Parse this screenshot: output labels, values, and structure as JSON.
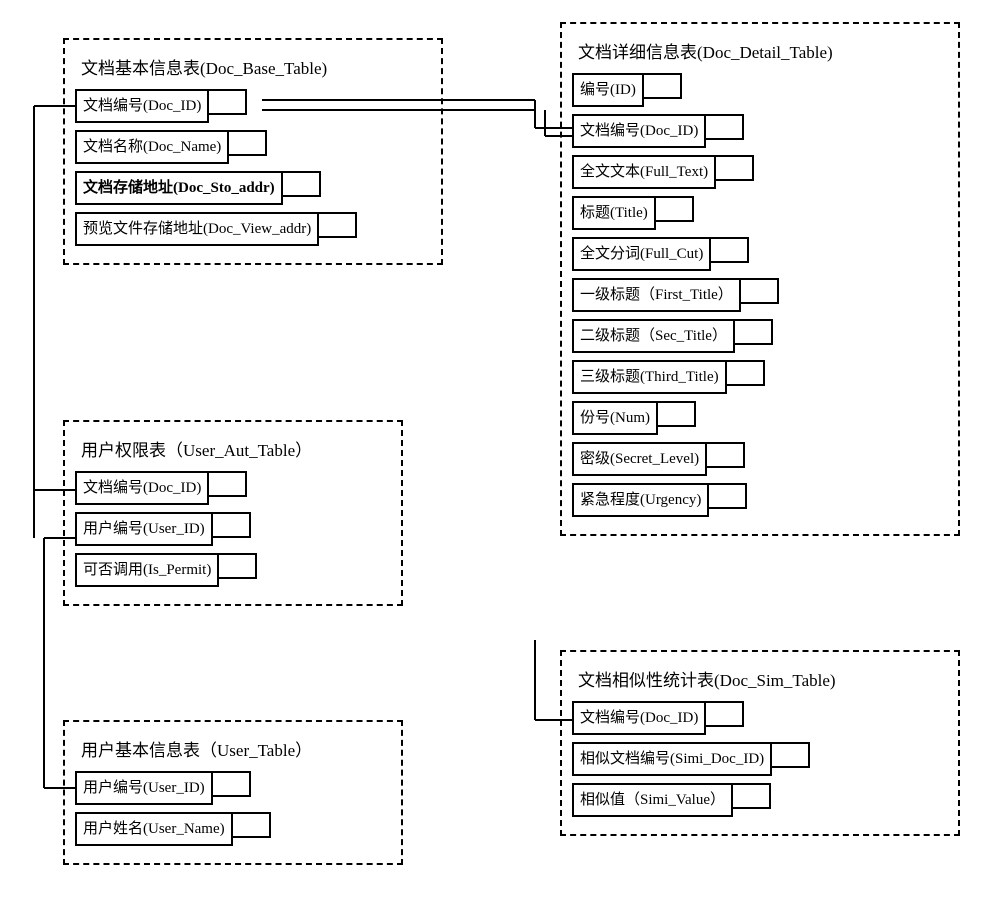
{
  "tables": {
    "doc_base": {
      "title": "文档基本信息表(Doc_Base_Table)",
      "fields": [
        "文档编号(Doc_ID)",
        "文档名称(Doc_Name)",
        "文档存储地址(Doc_Sto_addr)",
        "预览文件存储地址(Doc_View_addr)"
      ]
    },
    "user_aut": {
      "title": "用户权限表（User_Aut_Table）",
      "fields": [
        "文档编号(Doc_ID)",
        "用户编号(User_ID)",
        "可否调用(Is_Permit)"
      ]
    },
    "user_base": {
      "title": "用户基本信息表（User_Table）",
      "fields": [
        "用户编号(User_ID)",
        "用户姓名(User_Name)"
      ]
    },
    "doc_detail": {
      "title": "文档详细信息表(Doc_Detail_Table)",
      "fields": [
        "编号(ID)",
        "文档编号(Doc_ID)",
        "全文文本(Full_Text)",
        "标题(Title)",
        "全文分词(Full_Cut)",
        "一级标题（First_Title）",
        "二级标题（Sec_Title）",
        "三级标题(Third_Title)",
        "份号(Num)",
        "密级(Secret_Level)",
        "紧急程度(Urgency)"
      ]
    },
    "doc_sim": {
      "title": "文档相似性统计表(Doc_Sim_Table)",
      "fields": [
        "文档编号(Doc_ID)",
        "相似文档编号(Simi_Doc_ID)",
        "相似值（Simi_Value）"
      ]
    }
  }
}
